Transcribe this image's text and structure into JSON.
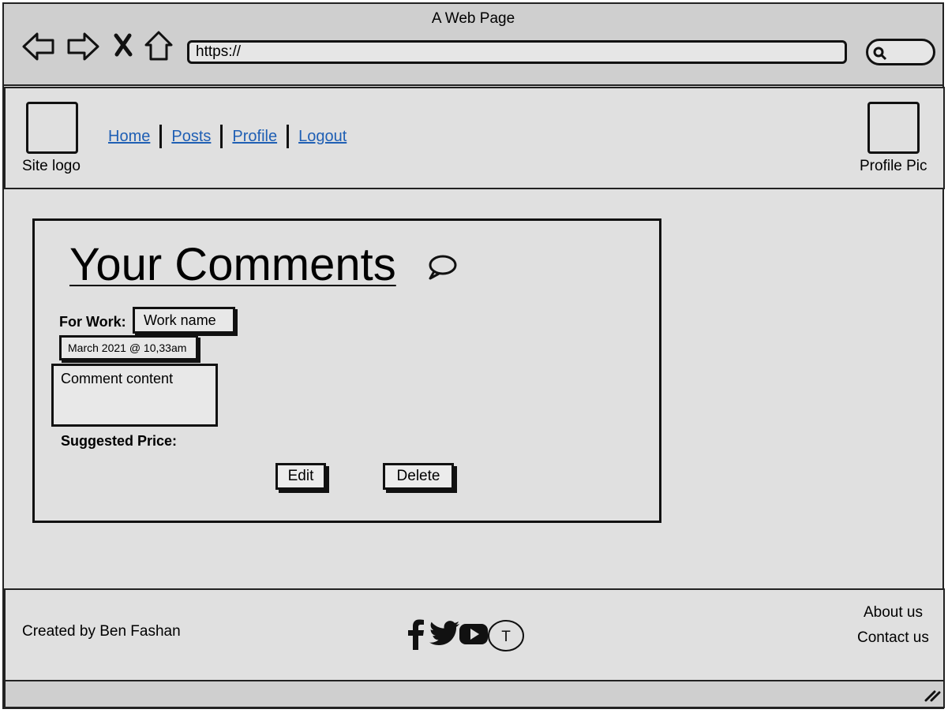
{
  "window": {
    "title": "A Web Page"
  },
  "browser": {
    "url": "https://"
  },
  "header": {
    "logo_label": "Site logo",
    "profile_label": "Profile Pic",
    "nav": [
      "Home",
      "Posts",
      "Profile",
      "Logout"
    ]
  },
  "card": {
    "title": "Your Comments",
    "for_work_label": "For Work:",
    "work_name": "Work name",
    "timestamp": "March 2021 @ 10,33am",
    "comment": "Comment content",
    "price_label": "Suggested Price:",
    "edit_label": "Edit",
    "delete_label": "Delete"
  },
  "footer": {
    "credit": "Created by Ben Fashan",
    "about": "About us",
    "contact": "Contact us",
    "social_icons": [
      "facebook-icon",
      "twitter-icon",
      "youtube-icon",
      "t-icon"
    ],
    "t_letter": "T"
  },
  "colors": {
    "link": "#1f5fb4",
    "background": "#e0e0e0",
    "browser_chrome": "#cfcfcf"
  }
}
